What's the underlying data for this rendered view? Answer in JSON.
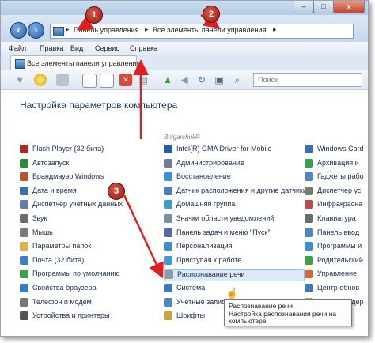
{
  "window": {
    "minimize": "–",
    "maximize": "□",
    "close": "x"
  },
  "address": {
    "segments": [
      "Панель управления",
      "Все элементы панели управления"
    ],
    "separator": "▸"
  },
  "menu": [
    "Файл",
    "Правка",
    "Вид",
    "Сервис",
    "Справка"
  ],
  "tab": {
    "label": "Все элементы панели управления"
  },
  "search": {
    "placeholder": "Поиск"
  },
  "page": {
    "heading": "Настройка параметров компьютера",
    "watermark": "BolgarchukR"
  },
  "columns": {
    "left": [
      {
        "label": "Flash Player (32 бита)",
        "icon": "flash-icon",
        "color": "#b3261e"
      },
      {
        "label": "Автозапуск",
        "icon": "autoplay-icon",
        "color": "#2e8b3a"
      },
      {
        "label": "Брандмауэр Windows",
        "icon": "firewall-icon",
        "color": "#b5562a"
      },
      {
        "label": "Дата и время",
        "icon": "clock-icon",
        "color": "#3b6fb6"
      },
      {
        "label": "Диспетчер учетных данных",
        "icon": "credentials-icon",
        "color": "#5a7fb0"
      },
      {
        "label": "Звук",
        "icon": "speaker-icon",
        "color": "#6b6b6b"
      },
      {
        "label": "Мышь",
        "icon": "mouse-icon",
        "color": "#7a7a7a"
      },
      {
        "label": "Параметры папок",
        "icon": "folder-icon",
        "color": "#d9b44a"
      },
      {
        "label": "Почта (32 бита)",
        "icon": "mail-icon",
        "color": "#3a7ccf"
      },
      {
        "label": "Программы по умолчанию",
        "icon": "default-programs-icon",
        "color": "#3aa04a"
      },
      {
        "label": "Свойства браузера",
        "icon": "browser-icon",
        "color": "#2f7fd1"
      },
      {
        "label": "Телефон и модем",
        "icon": "phone-icon",
        "color": "#777777"
      },
      {
        "label": "Устройства и принтеры",
        "icon": "printer-icon",
        "color": "#555555"
      }
    ],
    "middle": [
      {
        "label": "Intel(R) GMA Driver for Mobile",
        "icon": "intel-icon",
        "color": "#1d5fa8"
      },
      {
        "label": "Администрирование",
        "icon": "admin-tools-icon",
        "color": "#6c7e98"
      },
      {
        "label": "Восстановление",
        "icon": "recovery-icon",
        "color": "#3f8fd6"
      },
      {
        "label": "Датчик расположения и другие датчики",
        "icon": "sensor-icon",
        "color": "#4f7fb8"
      },
      {
        "label": "Домашняя группа",
        "icon": "homegroup-icon",
        "color": "#3aa0c9"
      },
      {
        "label": "Значки области уведомлений",
        "icon": "notification-icons-icon",
        "color": "#7b8ea8"
      },
      {
        "label": "Панель задач и меню \"Пуск\"",
        "icon": "taskbar-icon",
        "color": "#4d6e9c"
      },
      {
        "label": "Персонализация",
        "icon": "personalization-icon",
        "color": "#3a8fd0"
      },
      {
        "label": "Приступая к работе",
        "icon": "getting-started-icon",
        "color": "#3e9ad8"
      },
      {
        "label": "Распознавание речи",
        "icon": "microphone-icon",
        "color": "#8c9aab"
      },
      {
        "label": "Система",
        "icon": "system-icon",
        "color": "#3d78c1"
      },
      {
        "label": "Учетные записи",
        "icon": "accounts-icon",
        "color": "#4a86c8"
      },
      {
        "label": "Шрифты",
        "icon": "fonts-icon",
        "color": "#d0a23e"
      }
    ],
    "right": [
      {
        "label": "Windows Card",
        "icon": "cardspace-icon",
        "color": "#3d6fb0"
      },
      {
        "label": "Архивация и",
        "icon": "backup-icon",
        "color": "#3aa04a"
      },
      {
        "label": "Гаджеты рабо",
        "icon": "gadgets-icon",
        "color": "#4a86c8"
      },
      {
        "label": "Диспетчер ус",
        "icon": "device-manager-icon",
        "color": "#7a7a7a"
      },
      {
        "label": "Инфракрасна",
        "icon": "infrared-icon",
        "color": "#b94b4b"
      },
      {
        "label": "Клавиатура",
        "icon": "keyboard-icon",
        "color": "#6b6b6b"
      },
      {
        "label": "Панель ввод",
        "icon": "pen-icon",
        "color": "#4a86c8"
      },
      {
        "label": "Программы и",
        "icon": "programs-icon",
        "color": "#3a8fd0"
      },
      {
        "label": "Родительский",
        "icon": "parental-icon",
        "color": "#3aa04a"
      },
      {
        "label": "Управление",
        "icon": "color-icon",
        "color": "#d06a3a"
      },
      {
        "label": "Центр обнов",
        "icon": "update-icon",
        "color": "#3d78c1"
      },
      {
        "label": "Центр поддер",
        "icon": "action-center-icon",
        "color": "#d0a23e"
      }
    ]
  },
  "tooltip": {
    "title": "Распознавание речи",
    "line1": "Настройка распознавания речи на",
    "line2": "компьютере"
  },
  "annotations": {
    "badges": [
      "1",
      "2",
      "3"
    ],
    "arrow_color": "#e02020",
    "badge_color": "#b3261e"
  }
}
